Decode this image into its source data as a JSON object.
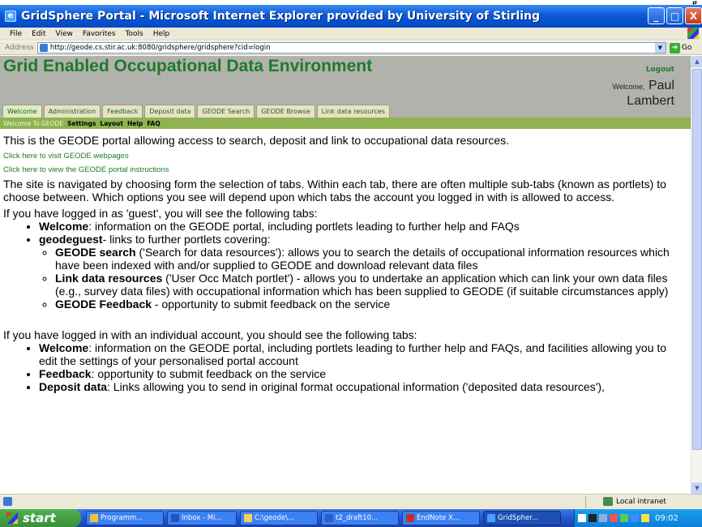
{
  "window": {
    "title": "GridSphere Portal - Microsoft Internet Explorer provided by University of Stirling",
    "top_fragment": "g",
    "controls": {
      "minimize": "_",
      "maximize": "□",
      "close": "X"
    }
  },
  "menu": [
    "File",
    "Edit",
    "View",
    "Favorites",
    "Tools",
    "Help"
  ],
  "address": {
    "label": "Address",
    "url": "http://geode.cs.stir.ac.uk:8080/gridsphere/gridsphere?cid=login",
    "go": "Go"
  },
  "portal": {
    "heading": "Grid Enabled Occupational Data Environment",
    "logout": "Logout",
    "welcome_label": "Welcome,",
    "user_first": "Paul",
    "user_last": "Lambert",
    "tabs": [
      "Welcome",
      "Administration",
      "Feedback",
      "Deposit data",
      "GEODE Search",
      "GEODE Browse",
      "Link data resources"
    ],
    "subnav": {
      "current": "Welcome To GEODE",
      "links": [
        "Settings",
        "Layout",
        "Help",
        "FAQ"
      ]
    }
  },
  "content": {
    "intro": "This is the GEODE portal allowing access to search, deposit and link to occupational data resources.",
    "link1": "Click here to visit GEODE webpages",
    "link2": "Click here to view the GEODE portal instructions",
    "nav_para": "The site is navigated by choosing form the selection of tabs. Within each tab, there are often multiple sub-tabs (known as portlets) to choose between. Which options you see will depend upon which tabs the account you logged in with is allowed to access.",
    "guest_intro": "If you have logged in as 'guest', you will see the following tabs:",
    "guest": {
      "welcome_b": "Welcome",
      "welcome_t": ": information on the GEODE portal, including portlets leading to further help and FAQs",
      "gg_b": "geodeguest",
      "gg_t": "- links to further portlets covering:",
      "s1_b": "GEODE search",
      "s1_t": " ('Search for data resources'): allows you to search the details of occupational information resources which have been indexed with and/or supplied to GEODE and download relevant data files",
      "s2_b": "Link data resources",
      "s2_t": " ('User Occ Match portlet') - allows you to undertake an application which can link your own data files (e.g., survey data files) with occupational information which has been supplied to GEODE (if suitable circumstances apply)",
      "s3_b": "GEODE Feedback",
      "s3_t": " - opportunity to submit feedback on the service"
    },
    "ind_intro": "If you have logged in with an individual account, you should see the following tabs:",
    "ind": {
      "welcome_b": "Welcome",
      "welcome_t": ": information on the GEODE portal, including portlets leading to further help and FAQs, and facilities allowing you to edit the settings of your personalised portal account",
      "fb_b": "Feedback",
      "fb_t": ": opportunity to submit feedback on the service",
      "dd_b": "Deposit data",
      "dd_t": ": Links allowing you to send in original format occupational information ('deposited data resources'),"
    }
  },
  "statusbar": {
    "zone": "Local intranet"
  },
  "taskbar": {
    "start": "start",
    "items": [
      "Programm...",
      "Inbox - Mi...",
      "C:\\geode\\...",
      "t2_draft10...",
      "EndNote X...",
      "GridSpher..."
    ],
    "clock": "09:02"
  },
  "colors": {
    "portal_green": "#1f7a2a",
    "banner_gray": "#b1b2ac",
    "subnav_green": "#8fb352",
    "xp_blue": "#0a5ad8"
  }
}
